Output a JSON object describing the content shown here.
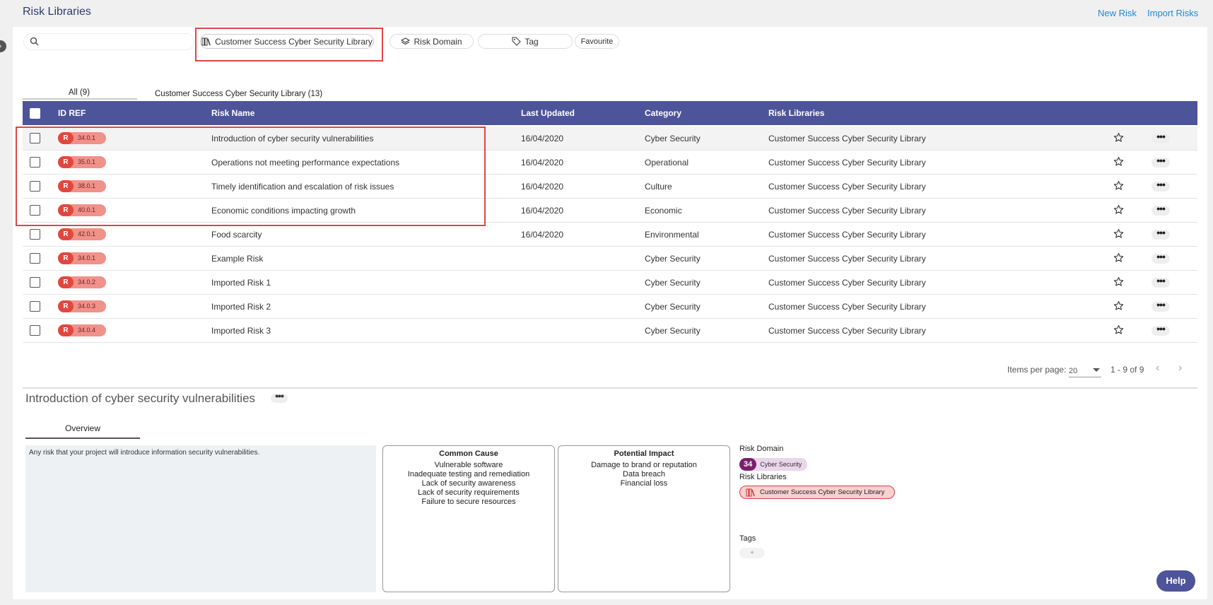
{
  "header": {
    "title": "Risk Libraries",
    "new_risk": "New Risk",
    "import_risks": "Import Risks"
  },
  "filters": {
    "search_placeholder": "",
    "library": "Customer Success Cyber Security Library",
    "risk_domain": "Risk Domain",
    "tag": "Tag",
    "favourite": "Favourite"
  },
  "tabs": [
    {
      "label": "All (9)"
    },
    {
      "label": "Customer Success Cyber Security Library (13)"
    }
  ],
  "table": {
    "headers": {
      "id_ref": "ID REF",
      "risk_name": "Risk Name",
      "last_updated": "Last Updated",
      "category": "Category",
      "risk_libraries": "Risk Libraries"
    },
    "rows": [
      {
        "badge": "R",
        "id": "34.0.1",
        "name": "Introduction of cyber security vulnerabilities",
        "updated": "16/04/2020",
        "category": "Cyber Security",
        "library": "Customer Success Cyber Security Library"
      },
      {
        "badge": "R",
        "id": "35.0.1",
        "name": "Operations not meeting performance expectations",
        "updated": "16/04/2020",
        "category": "Operational",
        "library": "Customer Success Cyber Security Library"
      },
      {
        "badge": "R",
        "id": "38.0.1",
        "name": "Timely identification and escalation of risk issues",
        "updated": "16/04/2020",
        "category": "Culture",
        "library": "Customer Success Cyber Security Library"
      },
      {
        "badge": "R",
        "id": "40.0.1",
        "name": "Economic conditions impacting growth",
        "updated": "16/04/2020",
        "category": "Economic",
        "library": "Customer Success Cyber Security Library"
      },
      {
        "badge": "R",
        "id": "42.0.1",
        "name": "Food scarcity",
        "updated": "16/04/2020",
        "category": "Environmental",
        "library": "Customer Success Cyber Security Library"
      },
      {
        "badge": "R",
        "id": "34.0.1",
        "name": "Example Risk",
        "updated": "",
        "category": "Cyber Security",
        "library": "Customer Success Cyber Security Library"
      },
      {
        "badge": "R",
        "id": "34.0.2",
        "name": "Imported Risk 1",
        "updated": "",
        "category": "Cyber Security",
        "library": "Customer Success Cyber Security Library"
      },
      {
        "badge": "R",
        "id": "34.0.3",
        "name": "Imported Risk 2",
        "updated": "",
        "category": "Cyber Security",
        "library": "Customer Success Cyber Security Library"
      },
      {
        "badge": "R",
        "id": "34.0.4",
        "name": "Imported Risk 3",
        "updated": "",
        "category": "Cyber Security",
        "library": "Customer Success Cyber Security Library"
      }
    ]
  },
  "pagination": {
    "items_per_page_label": "Items per page:",
    "items_per_page": "20",
    "range": "1 - 9 of 9",
    "prev": "‹",
    "next": "›"
  },
  "detail": {
    "title": "Introduction of cyber security vulnerabilities",
    "tab": "Overview",
    "description": "Any risk that your project will introduce information security vulnerabilities.",
    "common_cause": {
      "title": "Common Cause",
      "items": [
        "Vulnerable software",
        "Inadequate testing and remediation",
        "Lack of security awareness",
        "Lack of security requirements",
        "Failure to secure resources"
      ]
    },
    "potential_impact": {
      "title": "Potential Impact",
      "items": [
        "Damage to brand or reputation",
        "Data breach",
        "Financial loss"
      ]
    },
    "risk_domain_label": "Risk Domain",
    "risk_domain_num": "34",
    "risk_domain_name": "Cyber Security",
    "risk_libraries_label": "Risk Libraries",
    "risk_library": "Customer Success Cyber Security Library",
    "tags_label": "Tags",
    "tag_add": "+"
  },
  "help": "Help",
  "colors": {
    "header_bg": "#4e5499",
    "badge_r": "#e0483e",
    "badge_bg": "#f0918a",
    "link": "#1e88d4",
    "highlight_box": "#e04545"
  }
}
